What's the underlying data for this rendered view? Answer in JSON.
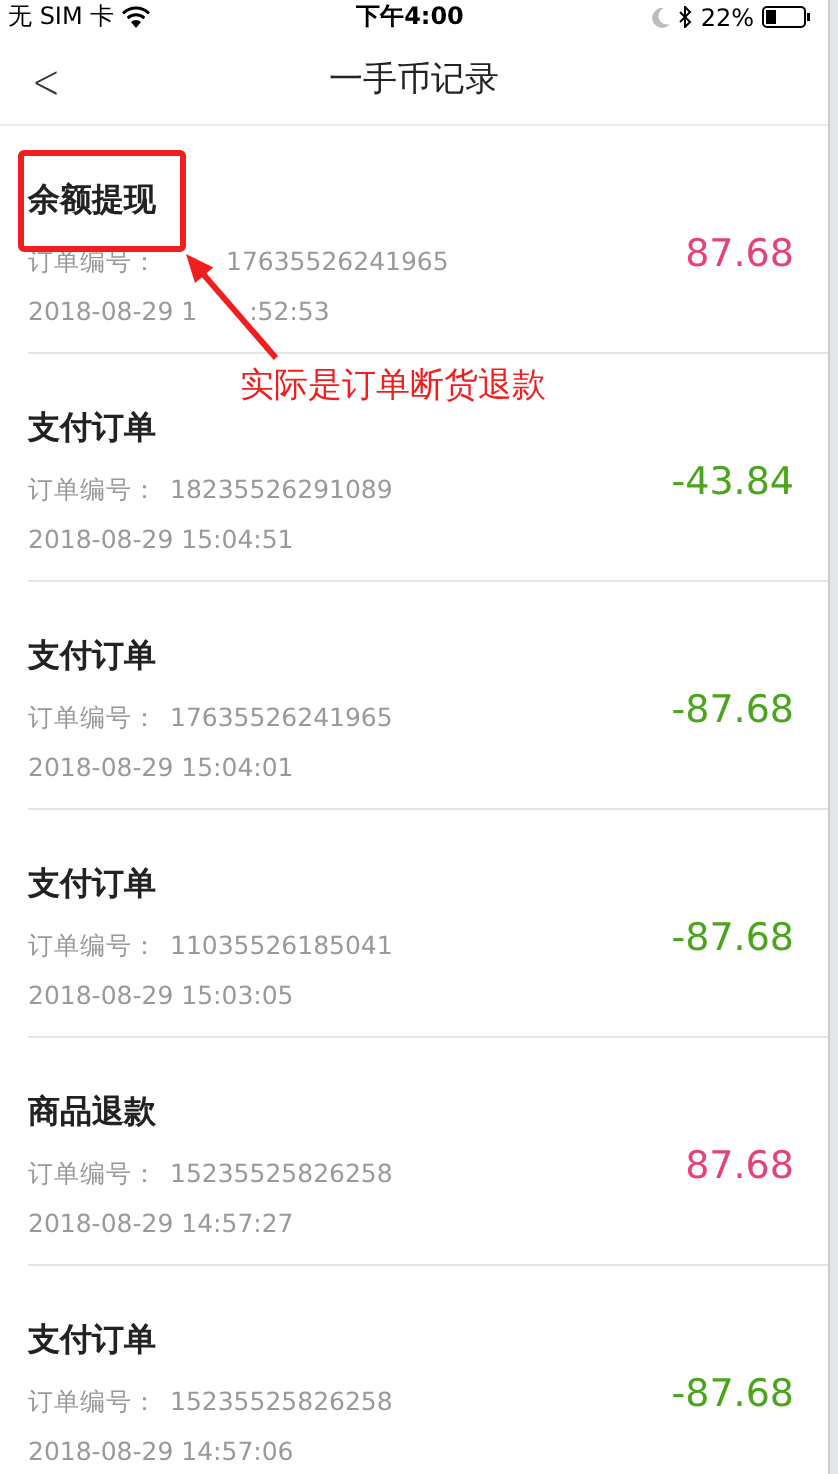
{
  "status_bar": {
    "carrier": "无 SIM 卡",
    "time": "下午4:00",
    "battery": "22%"
  },
  "nav": {
    "back": "<",
    "title": "一手币记录"
  },
  "records": [
    {
      "title": "余额提现",
      "order_label": "订单编号：",
      "order_no": "17635526241965",
      "time": "2018-08-29 1",
      "time_rest": ":52:53",
      "amount": "87.68",
      "kind": "income"
    },
    {
      "title": "支付订单",
      "order_label": "订单编号：",
      "order_no": "18235526291089",
      "time": "2018-08-29 15:04:51",
      "amount": "-43.84",
      "kind": "expense"
    },
    {
      "title": "支付订单",
      "order_label": "订单编号：",
      "order_no": "17635526241965",
      "time": "2018-08-29 15:04:01",
      "amount": "-87.68",
      "kind": "expense"
    },
    {
      "title": "支付订单",
      "order_label": "订单编号：",
      "order_no": "11035526185041",
      "time": "2018-08-29 15:03:05",
      "amount": "-87.68",
      "kind": "expense"
    },
    {
      "title": "商品退款",
      "order_label": "订单编号：",
      "order_no": "15235525826258",
      "time": "2018-08-29 14:57:27",
      "amount": "87.68",
      "kind": "income"
    },
    {
      "title": "支付订单",
      "order_label": "订单编号：",
      "order_no": "15235525826258",
      "time": "2018-08-29 14:57:06",
      "amount": "-87.68",
      "kind": "expense"
    }
  ],
  "annotation": {
    "text": "实际是订单断货退款"
  }
}
